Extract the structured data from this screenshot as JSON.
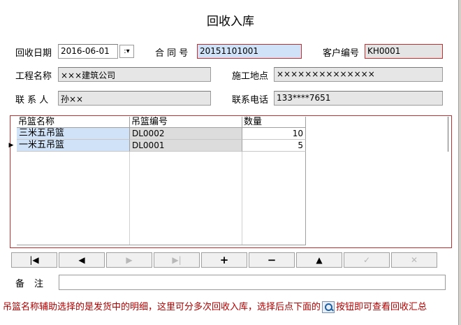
{
  "window": {
    "title": "回收入库"
  },
  "form": {
    "recycle_date_label": "回收日期",
    "recycle_date_value": "2016-06-01",
    "contract_no_label": "合 同 号",
    "contract_no_value": "20151101001",
    "customer_code_label": "客户编号",
    "customer_code_value": "KH0001",
    "project_name_label": "工程名称",
    "project_name_value": "×××建筑公司",
    "site_label": "施工地点",
    "site_value": "××××××××××××××",
    "contact_label": "联 系 人",
    "contact_value": "孙××",
    "phone_label": "联系电话",
    "phone_value": "133****7651"
  },
  "grid": {
    "columns": [
      "吊篮名称",
      "吊篮编号",
      "数量"
    ],
    "rows": [
      {
        "name": "三米五吊篮",
        "code": "DL0002",
        "qty": "10"
      },
      {
        "name": "一米五吊篮",
        "code": "DL0001",
        "qty": "5"
      }
    ]
  },
  "navigator": {
    "buttons": [
      {
        "name": "first-record-button",
        "glyph": "|◀",
        "enabled": true
      },
      {
        "name": "prior-record-button",
        "glyph": "◀",
        "enabled": true
      },
      {
        "name": "next-record-button",
        "glyph": "▶",
        "enabled": false
      },
      {
        "name": "last-record-button",
        "glyph": "▶|",
        "enabled": false
      },
      {
        "name": "insert-record-button",
        "glyph": "+",
        "enabled": true
      },
      {
        "name": "delete-record-button",
        "glyph": "−",
        "enabled": true
      },
      {
        "name": "edit-record-button",
        "glyph": "▲",
        "enabled": true
      },
      {
        "name": "post-record-button",
        "glyph": "✓",
        "enabled": false
      },
      {
        "name": "cancel-record-button",
        "glyph": "✕",
        "enabled": false
      }
    ]
  },
  "notes": {
    "label": "备注",
    "value": ""
  },
  "hint": {
    "text_before": "吊篮名称辅助选择的是发货中的明细，这里可分多次回收入库，选择后点下面的",
    "text_after": "按钮即可查看回收汇总"
  }
}
